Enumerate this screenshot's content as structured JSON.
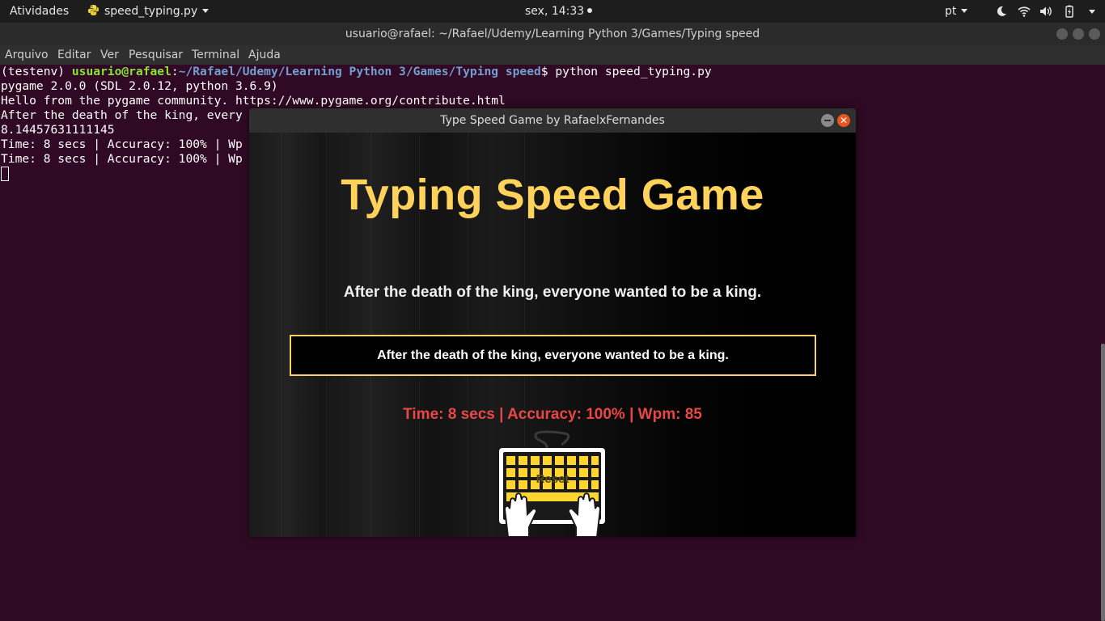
{
  "topbar": {
    "activities": "Atividades",
    "app_name": "speed_typing.py",
    "clock": "sex, 14:33",
    "language": "pt",
    "icons": [
      "moon-icon",
      "wifi-icon",
      "volume-icon",
      "battery-icon",
      "system-menu-caret-icon"
    ]
  },
  "terminal": {
    "title": "usuario@rafael: ~/Rafael/Udemy/Learning Python 3/Games/Typing speed",
    "menu": [
      "Arquivo",
      "Editar",
      "Ver",
      "Pesquisar",
      "Terminal",
      "Ajuda"
    ],
    "prompt_env": "(testenv) ",
    "prompt_user": "usuario@rafael",
    "prompt_colon": ":",
    "prompt_path": "~/Rafael/Udemy/Learning Python 3/Games/Typing speed",
    "prompt_command": "$ python speed_typing.py",
    "lines": [
      "pygame 2.0.0 (SDL 2.0.12, python 3.6.9)",
      "Hello from the pygame community. https://www.pygame.org/contribute.html",
      "After the death of the king, every",
      "8.14457631111145",
      "Time: 8 secs | Accuracy: 100% | Wp",
      "Time: 8 secs | Accuracy: 100% | Wp"
    ]
  },
  "game": {
    "window_title": "Type Speed Game by RafaelxFernandes",
    "close_glyph": "✕",
    "heading": "Typing Speed Game",
    "prompt_sentence": "After the death of the king, everyone wanted to be a king.",
    "typed_input": "After the death of the king, everyone wanted to be a king.",
    "result": "Time: 8 secs | Accuracy: 100% | Wpm: 85",
    "reset_label": "Reset"
  },
  "colors": {
    "terminal_bg": "#300a24",
    "heading": "#ffd25c",
    "result": "#ea4646",
    "input_border": "#ffcf6a",
    "keyboard_keys": "#ffd52e"
  }
}
